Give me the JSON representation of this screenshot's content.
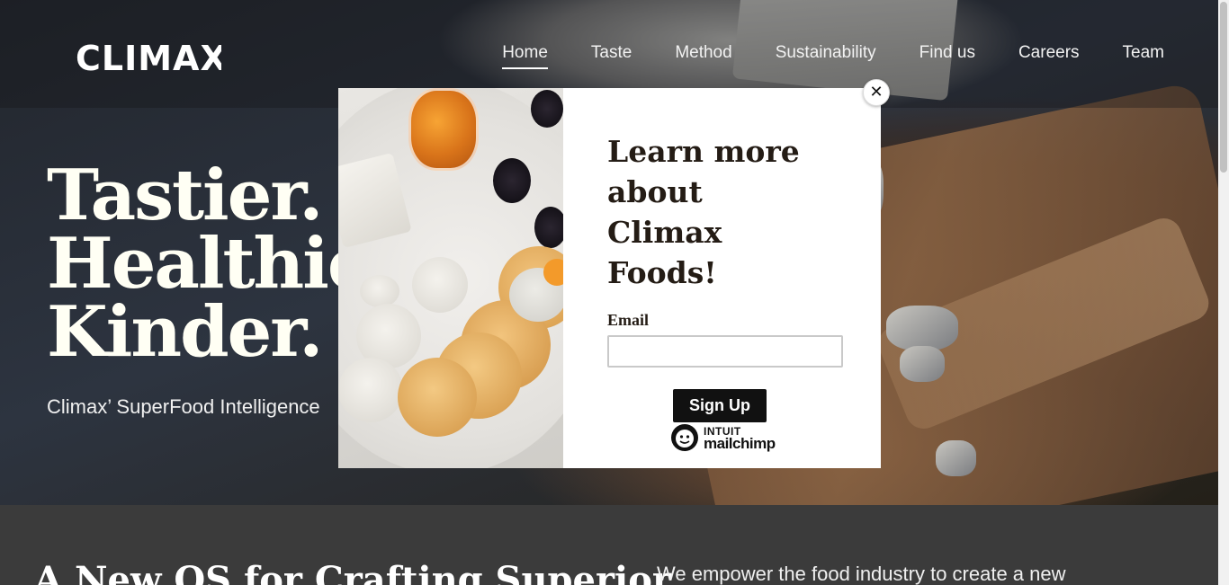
{
  "header": {
    "logo_text": "CLIMAX",
    "nav": [
      {
        "label": "Home",
        "active": true
      },
      {
        "label": "Taste"
      },
      {
        "label": "Method"
      },
      {
        "label": "Sustainability"
      },
      {
        "label": "Find us"
      },
      {
        "label": "Careers"
      },
      {
        "label": "Team"
      }
    ]
  },
  "hero": {
    "title_lines": [
      "Tastier.",
      "Healthier.",
      "Kinder."
    ],
    "subtitle": "Climax’ SuperFood Intelligence"
  },
  "section": {
    "title": "A New OS for Crafting Superior",
    "text": "We empower the food industry to create a new"
  },
  "modal": {
    "title": "Learn more about Climax Foods!",
    "email_label": "Email",
    "email_value": "",
    "email_placeholder": "",
    "signup_label": "Sign Up",
    "close_glyph": "✕",
    "brand_line1": "INTUIT",
    "brand_line2": "mailchimp"
  },
  "colors": {
    "modal_text": "#241c15",
    "button_bg": "#111111",
    "hero_text": "#fffff4"
  }
}
